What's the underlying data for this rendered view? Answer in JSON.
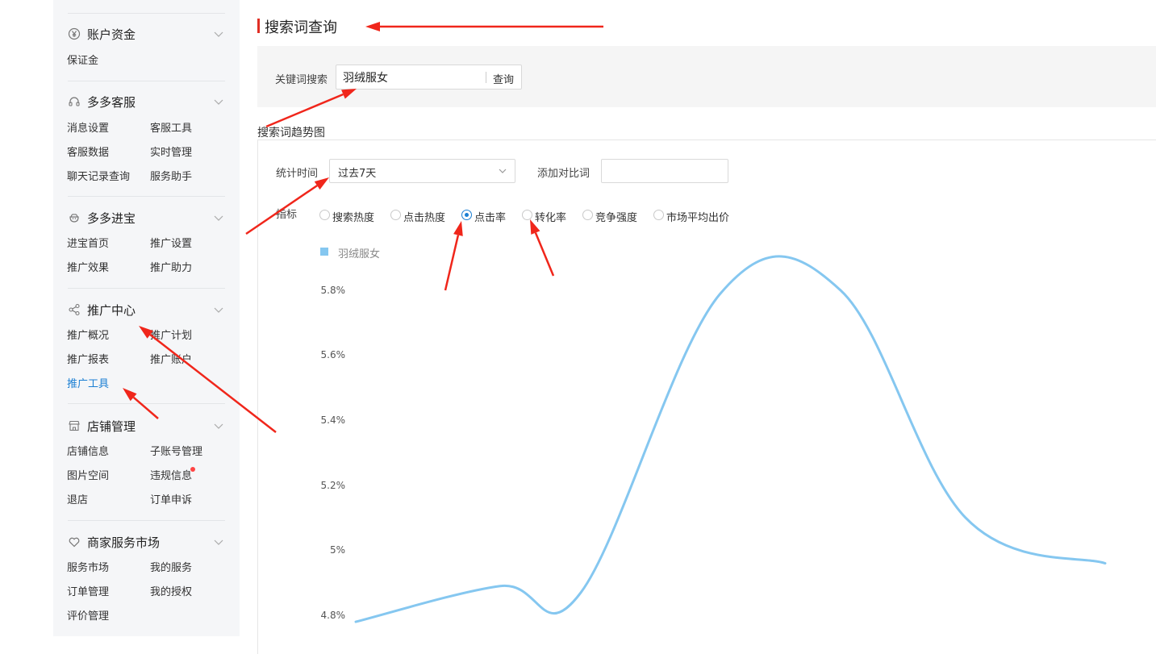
{
  "sidebar": {
    "sections": [
      {
        "title": "账户资金",
        "icon": "yen-circle-icon",
        "items": [
          "保证金"
        ]
      },
      {
        "title": "多多客服",
        "icon": "headset-icon",
        "items": [
          "消息设置",
          "客服工具",
          "客服数据",
          "实时管理",
          "聊天记录查询",
          "服务助手"
        ]
      },
      {
        "title": "多多进宝",
        "icon": "treasure-pot-icon",
        "items": [
          "进宝首页",
          "推广设置",
          "推广效果",
          "推广助力"
        ]
      },
      {
        "title": "推广中心",
        "icon": "share-nodes-icon",
        "items": [
          "推广概况",
          "推广计划",
          "推广报表",
          "推广账户",
          "推广工具"
        ],
        "active_item": "推广工具"
      },
      {
        "title": "店铺管理",
        "icon": "store-icon",
        "items": [
          "店铺信息",
          "子账号管理",
          "图片空间",
          "违规信息",
          "退店",
          "订单申诉"
        ]
      },
      {
        "title": "商家服务市场",
        "icon": "heart-icon",
        "items": [
          "服务市场",
          "我的服务",
          "订单管理",
          "我的授权",
          "评价管理"
        ]
      }
    ]
  },
  "main": {
    "title": "搜索词查询",
    "keyword_label": "关键词搜索",
    "keyword_value": "羽绒服女",
    "query_button": "查询",
    "trend_title": "搜索词趋势图",
    "time_label": "统计时间",
    "time_value": "过去7天",
    "compare_label": "添加对比词",
    "metric_label": "指标",
    "metrics": [
      "搜索热度",
      "点击热度",
      "点击率",
      "转化率",
      "竞争强度",
      "市场平均出价"
    ],
    "selected_metric": "点击率"
  },
  "chart_data": {
    "type": "line",
    "series": [
      {
        "name": "羽绒服女",
        "color": "#85c7f0",
        "values": [
          4.78,
          4.89,
          4.87,
          5.79,
          5.8,
          5.1,
          4.96
        ]
      }
    ],
    "y_ticks": [
      "5.8%",
      "5.6%",
      "5.4%",
      "5.2%",
      "5%",
      "4.8%"
    ],
    "ylim": [
      4.8,
      5.8
    ],
    "xlabel": "",
    "ylabel": "",
    "legend_position": "top-left"
  }
}
